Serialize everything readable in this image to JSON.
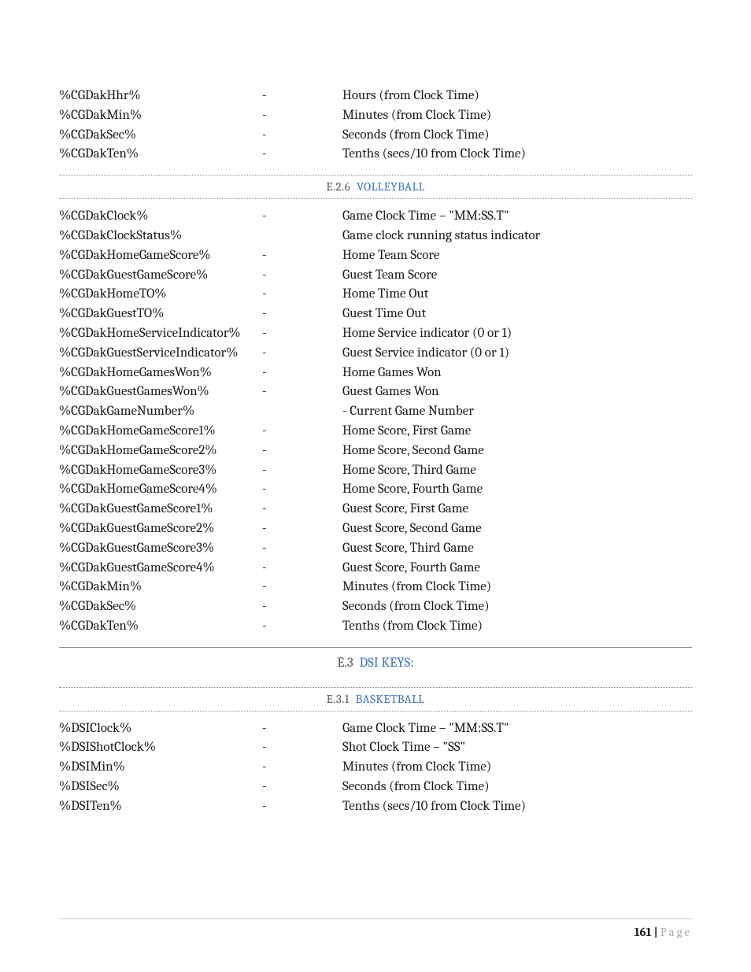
{
  "top_rows": [
    {
      "key": "%CGDakHhr%",
      "dash": "-",
      "desc": "Hours (from Clock Time)"
    },
    {
      "key": "%CGDakMin%",
      "dash": "-",
      "desc": "Minutes (from Clock Time)"
    },
    {
      "key": "%CGDakSec%",
      "dash": "-",
      "desc": "Seconds (from Clock Time)"
    },
    {
      "key": "%CGDakTen%",
      "dash": "-",
      "desc": "Tenths (secs/10 from Clock Time)"
    }
  ],
  "sub1": {
    "num": "E.2.6",
    "title": "VOLLEYBALL"
  },
  "volley_rows": [
    {
      "key": "%CGDakClock%",
      "dash": "-",
      "desc": "Game Clock Time – \"MM:SS.T\""
    },
    {
      "key": "%CGDakClockStatus%",
      "dash": "",
      "desc": "Game clock running status indicator"
    },
    {
      "key": "%CGDakHomeGameScore%",
      "dash": "-",
      "desc": "Home Team Score"
    },
    {
      "key": "%CGDakGuestGameScore%",
      "dash": "-",
      "desc": "Guest Team Score"
    },
    {
      "key": "%CGDakHomeTO%",
      "dash": "-",
      "desc": "Home Time Out"
    },
    {
      "key": "%CGDakGuestTO%",
      "dash": "-",
      "desc": "Guest Time Out"
    },
    {
      "key": "%CGDakHomeServiceIndicator%",
      "dash": "-",
      "desc": "Home Service indicator (0 or 1)"
    },
    {
      "key": "%CGDakGuestServiceIndicator%",
      "dash": "-",
      "desc": "Guest Service indicator (0 or 1)"
    },
    {
      "key": "%CGDakHomeGamesWon%",
      "dash": "-",
      "desc": "Home Games Won"
    },
    {
      "key": "%CGDakGuestGamesWon%",
      "dash": "-",
      "desc": "Guest Games Won"
    },
    {
      "key": "%CGDakGameNumber%",
      "dash": "",
      "desc": "- Current Game Number"
    },
    {
      "key": "%CGDakHomeGameScore1%",
      "dash": "-",
      "desc": "Home Score, First Game"
    },
    {
      "key": "%CGDakHomeGameScore2%",
      "dash": "-",
      "desc": "Home Score, Second Game"
    },
    {
      "key": "%CGDakHomeGameScore3%",
      "dash": "-",
      "desc": "Home Score, Third Game"
    },
    {
      "key": "%CGDakHomeGameScore4%",
      "dash": "-",
      "desc": "Home Score, Fourth Game"
    },
    {
      "key": "%CGDakGuestGameScore1%",
      "dash": "-",
      "desc": "Guest Score, First Game"
    },
    {
      "key": "%CGDakGuestGameScore2%",
      "dash": "-",
      "desc": "Guest Score, Second Game"
    },
    {
      "key": "%CGDakGuestGameScore3%",
      "dash": "-",
      "desc": "Guest Score, Third Game"
    },
    {
      "key": "%CGDakGuestGameScore4%",
      "dash": "-",
      "desc": "Guest Score, Fourth Game"
    },
    {
      "key": "%CGDakMin%",
      "dash": "-",
      "desc": "Minutes (from Clock Time)"
    },
    {
      "key": "%CGDakSec%",
      "dash": "-",
      "desc": "Seconds (from Clock Time)"
    },
    {
      "key": "%CGDakTen%",
      "dash": "-",
      "desc": "Tenths (from Clock Time)"
    }
  ],
  "major": {
    "num": "E.3",
    "title": "DSI K",
    "title_rest": "EYS:"
  },
  "sub2": {
    "num": "E.3.1",
    "title": "BASKETBALL"
  },
  "bball_rows": [
    {
      "key": "%DSIClock%",
      "dash": "-",
      "desc": "Game Clock Time – \"MM:SS.T\""
    },
    {
      "key": "%DSIShotClock%",
      "dash": "-",
      "desc": "Shot Clock Time – \"SS\""
    },
    {
      "key": "%DSIMin%",
      "dash": "-",
      "desc": "Minutes (from Clock Time)"
    },
    {
      "key": "%DSISec%",
      "dash": "-",
      "desc": "Seconds (from Clock Time)"
    },
    {
      "key": "%DSITen%",
      "dash": "-",
      "desc": "Tenths (secs/10 from Clock Time)"
    }
  ],
  "footer": {
    "pnum": "161 | ",
    "ptxt": "Page"
  }
}
